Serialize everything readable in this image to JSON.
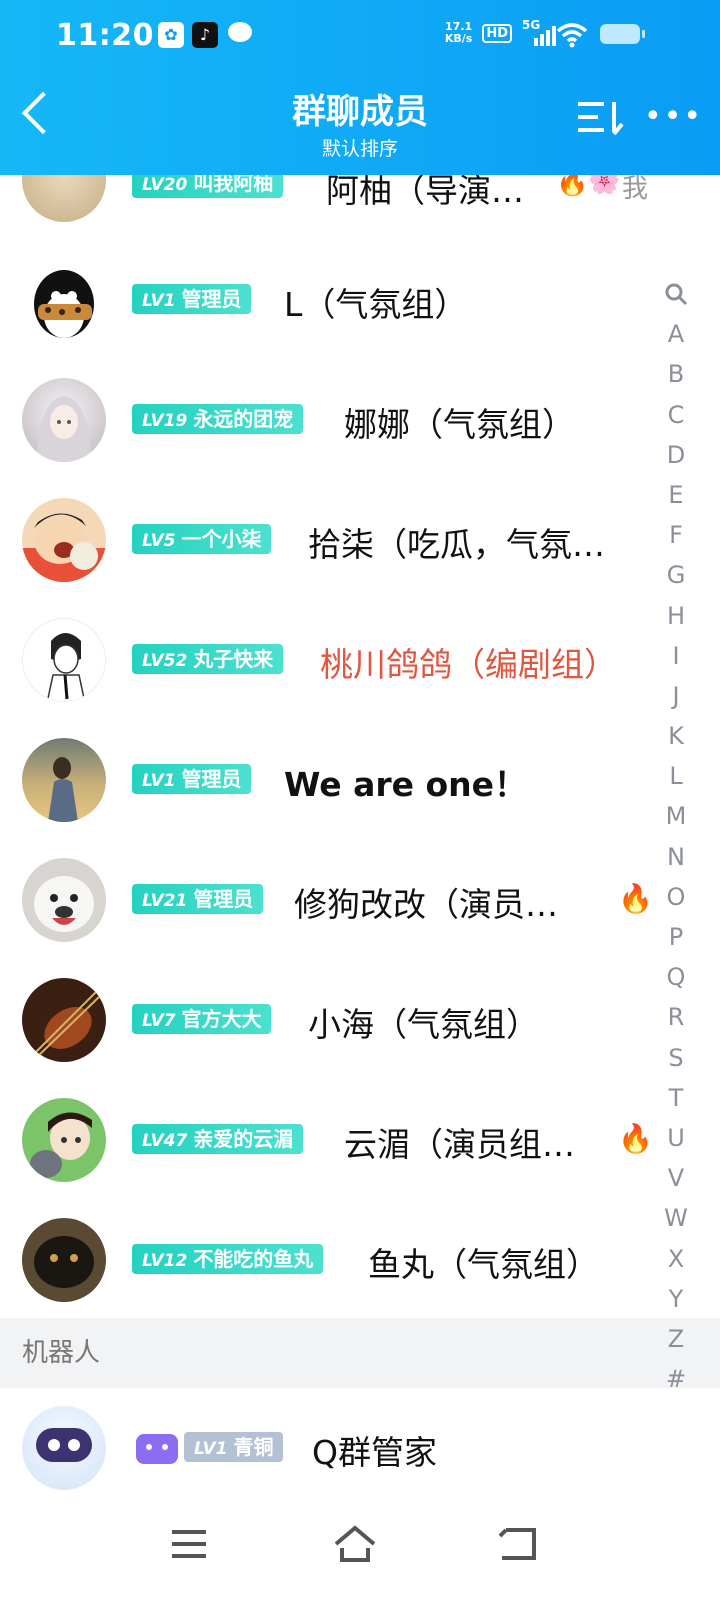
{
  "status": {
    "time": "11:20",
    "net_speed": "17.1",
    "net_unit": "KB/s",
    "hd": "HD",
    "network": "5G"
  },
  "header": {
    "title": "群聊成员",
    "subtitle": "默认排序"
  },
  "members": [
    {
      "level": "LV20",
      "title": "叫我阿柚",
      "name": "阿柚（导演…",
      "extra": "我",
      "fire": true,
      "name_color": "#111111"
    },
    {
      "level": "LV1",
      "title": "管理员",
      "name": "L（气氛组）",
      "fire": false,
      "name_color": "#111111"
    },
    {
      "level": "LV19",
      "title": "永远的团宠",
      "name": "娜娜（气氛组）",
      "fire": false,
      "name_color": "#111111"
    },
    {
      "level": "LV5",
      "title": "一个小柒",
      "name": "拾柒（吃瓜，气氛…",
      "fire": false,
      "name_color": "#111111"
    },
    {
      "level": "LV52",
      "title": "丸子快来",
      "name": "桃川鸽鸽（编剧组）",
      "fire": false,
      "name_color": "#e2563f"
    },
    {
      "level": "LV1",
      "title": "管理员",
      "name": "We are one！",
      "fire": false,
      "name_color": "#111111"
    },
    {
      "level": "LV21",
      "title": "管理员",
      "name": "修狗改改（演员…",
      "fire": true,
      "name_color": "#111111"
    },
    {
      "level": "LV7",
      "title": "官方大大",
      "name": "小海（气氛组）",
      "fire": false,
      "name_color": "#111111"
    },
    {
      "level": "LV47",
      "title": "亲爱的云湄",
      "name": "云湄（演员组…",
      "fire": true,
      "name_color": "#111111"
    },
    {
      "level": "LV12",
      "title": "不能吃的鱼丸",
      "name": "鱼丸（气氛组）",
      "fire": false,
      "name_color": "#111111"
    }
  ],
  "index_letters": [
    "A",
    "B",
    "C",
    "D",
    "E",
    "F",
    "G",
    "H",
    "I",
    "J",
    "K",
    "L",
    "M",
    "N",
    "O",
    "P",
    "Q",
    "R",
    "S",
    "T",
    "U",
    "V",
    "W",
    "X",
    "Y",
    "Z",
    "#"
  ],
  "robots": {
    "section_label": "机器人",
    "bot": {
      "level": "LV1",
      "title": "青铜",
      "name": "Q群管家"
    }
  },
  "fire_icon": "flame-icon",
  "colors": {
    "header": "#0a9cf4",
    "badge": "#2ad3c2",
    "highlight_name": "#e2563f"
  }
}
